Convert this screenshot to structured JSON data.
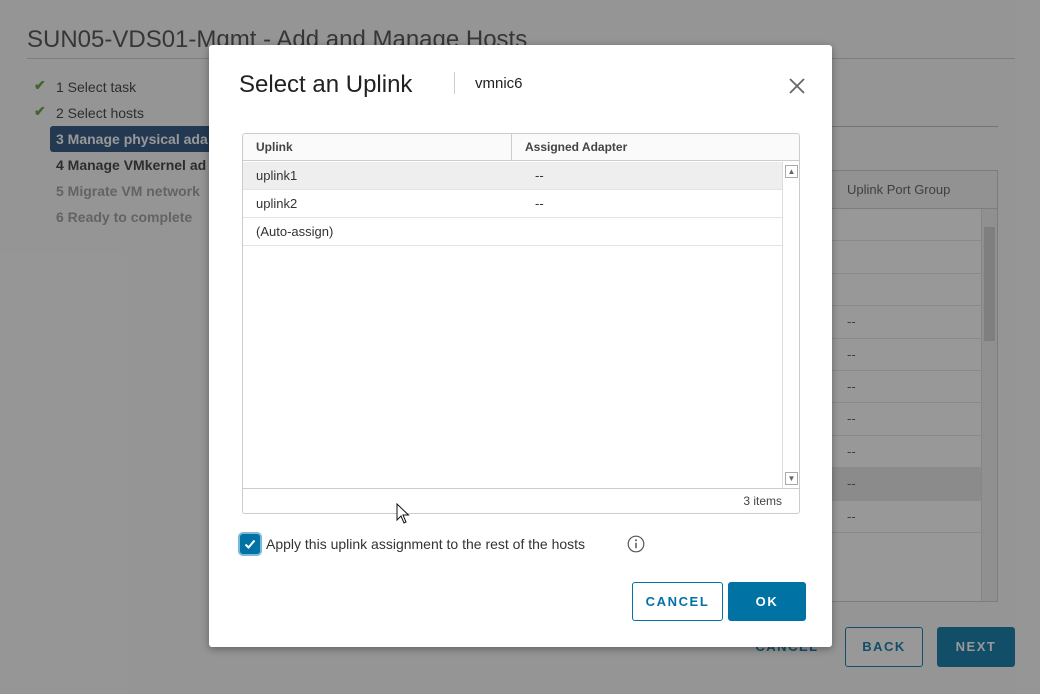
{
  "wizard": {
    "title": "SUN05-VDS01-Mgmt - Add and Manage Hosts",
    "steps": [
      {
        "label": "1 Select task",
        "state": "done"
      },
      {
        "label": "2 Select hosts",
        "state": "done"
      },
      {
        "label": "3 Manage physical ada",
        "state": "active"
      },
      {
        "label": "4 Manage VMkernel ad",
        "state": "pending"
      },
      {
        "label": "5 Migrate VM network",
        "state": "disabled"
      },
      {
        "label": "6 Ready to complete",
        "state": "disabled"
      }
    ],
    "grid_header": "Uplink Port Group",
    "grid_rows": [
      "",
      "",
      "",
      "--",
      "--",
      "--",
      "--",
      "--",
      "--",
      "--",
      "--",
      ""
    ],
    "buttons": {
      "cancel": "CANCEL",
      "back": "BACK",
      "next": "NEXT"
    }
  },
  "dialog": {
    "title": "Select an Uplink",
    "subtitle": "vmnic6",
    "columns": [
      "Uplink",
      "Assigned Adapter"
    ],
    "rows": [
      {
        "uplink": "uplink1",
        "adapter": "--",
        "selected": true
      },
      {
        "uplink": "uplink2",
        "adapter": "--",
        "selected": false
      },
      {
        "uplink": "(Auto-assign)",
        "adapter": "",
        "selected": false
      }
    ],
    "item_count": "3 items",
    "apply_checkbox": {
      "label": "Apply this uplink assignment to the rest of the hosts",
      "checked": true
    },
    "buttons": {
      "cancel": "CANCEL",
      "ok": "OK"
    }
  },
  "colors": {
    "primary": "#0072a3",
    "wizard_active_step": "#1d4a78",
    "check_green": "#5a9e2e"
  }
}
